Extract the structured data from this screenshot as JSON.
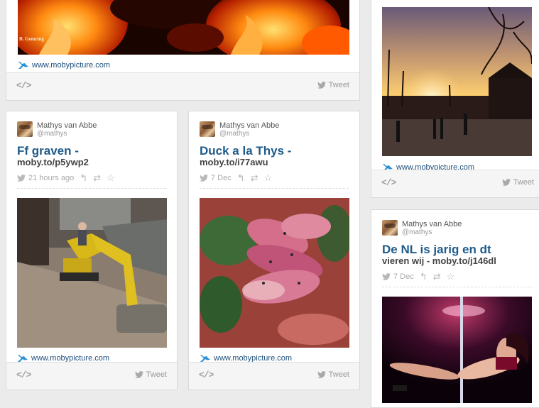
{
  "common": {
    "embed_label": "</>",
    "tweet_label": "Tweet",
    "site_link": "www.mobypicture.com",
    "author_name": "Mathys van Abbe",
    "author_handle": "@mathys",
    "twitter_blue": "#55acee",
    "title_blue": "#1e5b8a"
  },
  "cards": {
    "top_left": {
      "watermark": "B. Gemring",
      "link": "www.mobypicture.com"
    },
    "top_right": {
      "link": "www.mobypicture.com"
    },
    "ff_graven": {
      "title": "Ff graven -",
      "short_url": "moby.to/p5ywp2",
      "time": "21 hours ago",
      "link": "www.mobypicture.com"
    },
    "duck": {
      "title": "Duck a la Thys -",
      "short_url": "moby.to/i77awu",
      "time": "7 Dec",
      "link": "www.mobypicture.com"
    },
    "nl_jarig": {
      "title": "De NL is jarig en dt",
      "subtitle": "vieren wij - moby.to/j146dl",
      "time": "7 Dec"
    }
  },
  "icons": [
    "embed-code-icon",
    "twitter-bird-icon",
    "moby-whale-icon",
    "reply-icon",
    "retweet-icon",
    "favorite-star-icon"
  ]
}
